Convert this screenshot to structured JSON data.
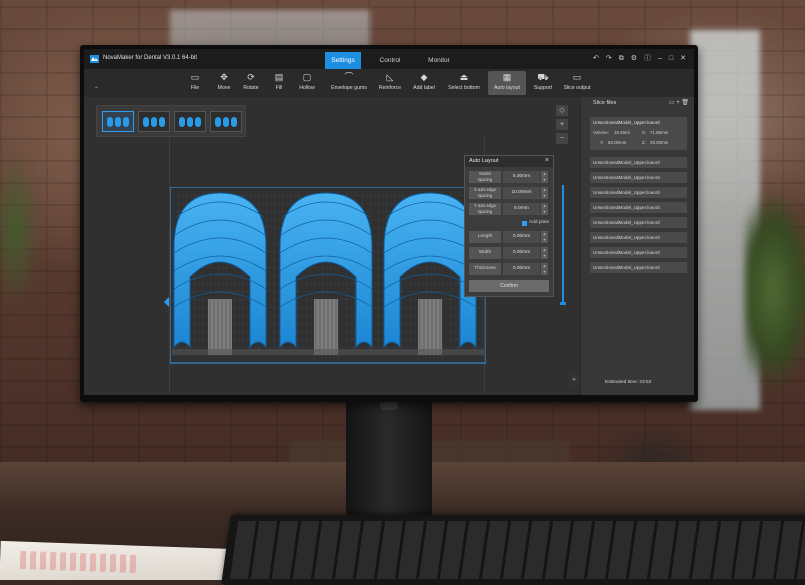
{
  "app": {
    "title": "NovaMaker for Dental V3.0.1 64-bit",
    "tabs": [
      {
        "label": "Settings",
        "active": true
      },
      {
        "label": "Control",
        "active": false
      },
      {
        "label": "Monitor",
        "active": false
      }
    ],
    "accent_color": "#1e8fe0"
  },
  "toolbar": {
    "tools": [
      {
        "label": "File",
        "icon": "folder-icon"
      },
      {
        "label": "Move",
        "icon": "move-icon"
      },
      {
        "label": "Rotate",
        "icon": "rotate-icon"
      },
      {
        "label": "Fill",
        "icon": "fill-icon"
      },
      {
        "label": "Hollow",
        "icon": "hollow-icon"
      },
      {
        "label": "Envelope gums",
        "icon": "envelope-gums-icon"
      },
      {
        "label": "Reinforce",
        "icon": "reinforce-icon"
      },
      {
        "label": "Add label",
        "icon": "label-icon"
      },
      {
        "label": "Select bottom",
        "icon": "select-bottom-icon"
      },
      {
        "label": "Auto layout",
        "icon": "auto-layout-icon",
        "active": true
      },
      {
        "label": "Support",
        "icon": "support-icon"
      },
      {
        "label": "Slice output",
        "icon": "slice-output-icon"
      }
    ]
  },
  "auto_layout": {
    "title": "Auto Layout",
    "fields": [
      {
        "label_line1": "Model",
        "label_line2": "spacing",
        "value": "5.00mm"
      },
      {
        "label_line1": "X axis edge",
        "label_line2": "spacing",
        "value": "10.00mm"
      },
      {
        "label_line1": "Y axis edge",
        "label_line2": "spacing",
        "value": "5.0mm"
      }
    ],
    "add_plate_label": "Add plate",
    "add_plate_checked": true,
    "size_fields": [
      {
        "label": "Length",
        "value": "0.00mm"
      },
      {
        "label": "Width",
        "value": "0.00mm"
      },
      {
        "label": "Thickness",
        "value": "0.00mm"
      }
    ],
    "confirm_label": "Confirm"
  },
  "slice_files": {
    "title": "Slice files",
    "first": {
      "name": "UnsectionedModel_Upper.low.stl",
      "volume_label": "Volume:",
      "volume": "15.45ml",
      "x_label": "X:",
      "x": "71.86mm",
      "y_label": "Y:",
      "y": "50.00mm",
      "z_label": "Z:",
      "z": "20.00mm"
    },
    "items": [
      "UnsectionedModel_Upper.low.stl",
      "UnsectionedModel_Upper.low.stl",
      "UnsectionedModel_Upper.low.stl",
      "UnsectionedModel_Upper.low.stl",
      "UnsectionedModel_Upper.low.stl",
      "UnsectionedModel_Upper.low.stl",
      "UnsectionedModel_Upper.low.stl",
      "UnsectionedModel_Upper.low.stl"
    ],
    "estimated_time": "Estimated time: 23:52"
  },
  "viewport": {
    "thumbnail_count": 4,
    "active_thumbnail": 1,
    "layer_slider_fraction": 1.0,
    "model_color": "#2a9be6"
  }
}
